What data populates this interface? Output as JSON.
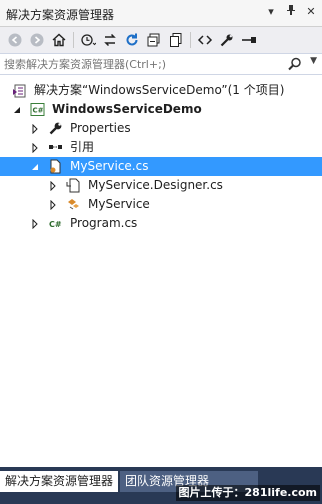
{
  "window": {
    "title": "解决方案资源管理器",
    "controls": [
      "dropdown-icon",
      "pin-icon",
      "close-icon"
    ]
  },
  "toolbar": {
    "buttons": [
      "back-icon",
      "forward-icon",
      "home-icon",
      "history-icon",
      "sync-icon",
      "refresh-icon",
      "collapse-all-icon",
      "show-all-files-icon",
      "view-code-icon",
      "properties-icon",
      "preview-icon"
    ]
  },
  "search": {
    "placeholder": "搜索解决方案资源管理器(Ctrl+;)"
  },
  "tree": {
    "solution": "解决方案“WindowsServiceDemo”(1 个项目)",
    "project": "WindowsServiceDemo",
    "properties": "Properties",
    "references": "引用",
    "myservice_cs": "MyService.cs",
    "designer": "MyService.Designer.cs",
    "myservice": "MyService",
    "program": "Program.cs"
  },
  "tabs": {
    "solution_explorer": "解决方案资源管理器",
    "team_explorer": "团队资源管理器"
  },
  "watermark": "图片上传于：281life.com",
  "colors": {
    "selection": "#3399ff",
    "frame": "#293955"
  }
}
